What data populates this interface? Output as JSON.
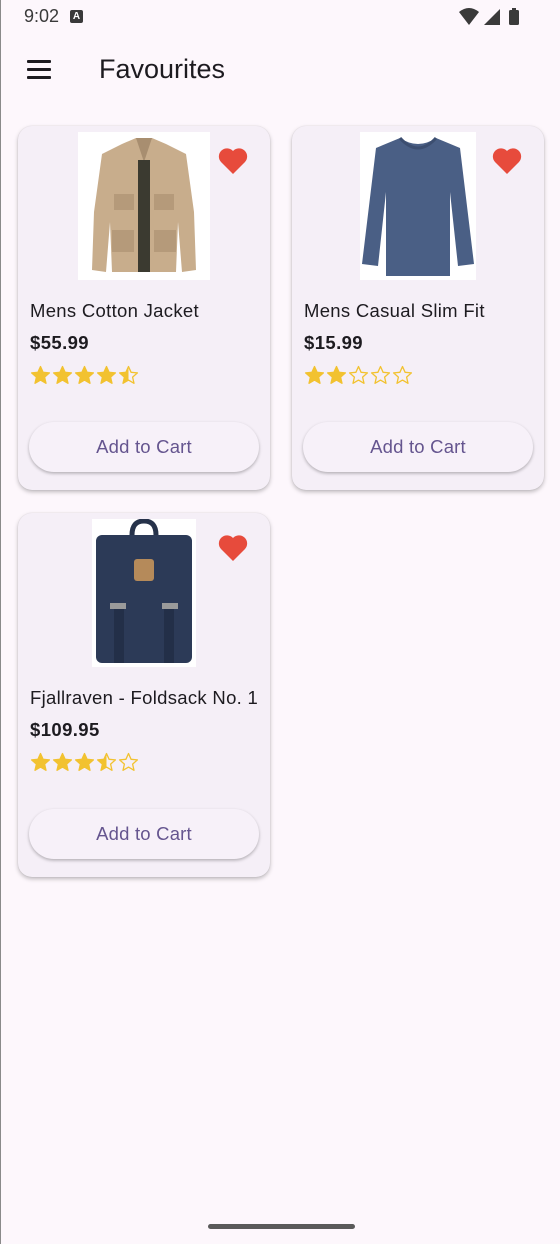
{
  "status_bar": {
    "time": "9:02",
    "notification_badge": "A"
  },
  "app_bar": {
    "title": "Favourites",
    "menu_icon": "hamburger-menu-icon"
  },
  "colors": {
    "star": "#f2c230",
    "heart": "#e74b3c",
    "accent": "#65558f",
    "background": "#fdf7fc",
    "card": "#f5eff7"
  },
  "products": [
    {
      "title": "Mens Cotton Jacket",
      "price": "$55.99",
      "rating": 4.5,
      "button_label": "Add to Cart",
      "image": "jacket",
      "favourite": true
    },
    {
      "title": "Mens Casual Slim Fit",
      "price": "$15.99",
      "rating": 2,
      "button_label": "Add to Cart",
      "image": "long-sleeve-shirt",
      "favourite": true
    },
    {
      "title": "Fjallraven - Foldsack No. 1",
      "price": "$109.95",
      "rating": 3.5,
      "button_label": "Add to Cart",
      "image": "backpack",
      "favourite": true
    }
  ]
}
